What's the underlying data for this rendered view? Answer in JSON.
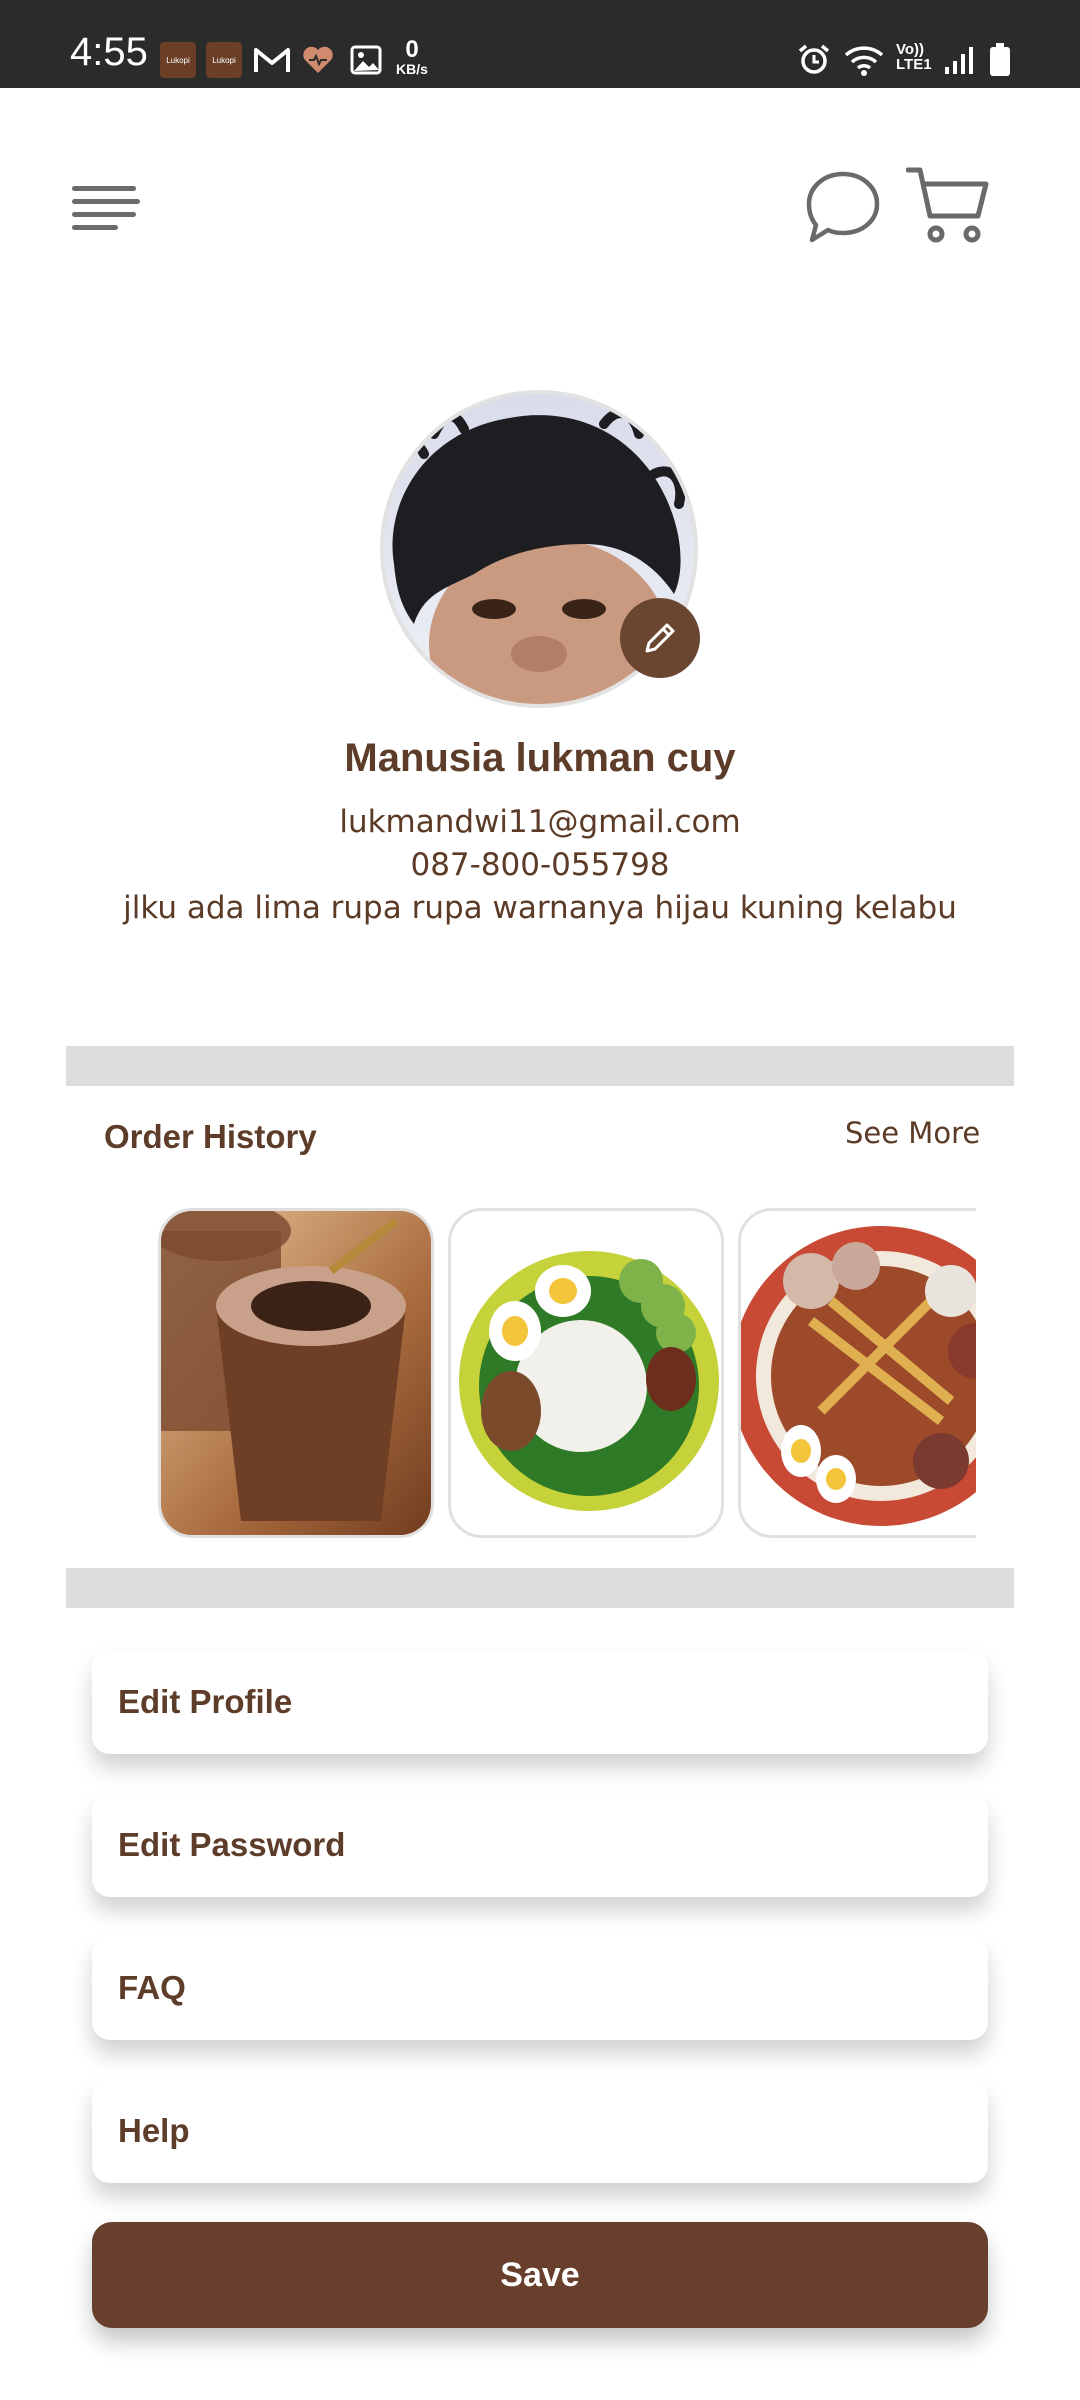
{
  "status_bar": {
    "time": "4:55",
    "app_icon_1": "Lukopi",
    "app_icon_2": "Lukopi",
    "net_speed_value": "0",
    "net_speed_unit": "KB/s",
    "lte_label_1": "Vo))",
    "lte_label_2": "LTE1",
    "icons": [
      "gmail-icon",
      "health-icon",
      "gallery-icon",
      "alarm-icon",
      "wifi-icon",
      "signal-icon",
      "battery-icon"
    ]
  },
  "header": {
    "icons": [
      "menu-icon",
      "chat-icon",
      "cart-icon"
    ]
  },
  "profile": {
    "name": "Manusia lukman cuy",
    "email": "lukmandwi11@gmail.com",
    "phone": "087-800-055798",
    "bio": "jlku ada lima rupa rupa warnanya hijau kuning kelabu"
  },
  "order_history": {
    "title": "Order History",
    "see_more": "See More",
    "items": [
      "chocolate-drink",
      "nasi-lemak",
      "mixed-salad-platter"
    ]
  },
  "menu": {
    "edit_profile": "Edit Profile",
    "edit_password": "Edit Password",
    "faq": "FAQ",
    "help": "Help"
  },
  "save_label": "Save",
  "colors": {
    "primary_brown": "#673f2c",
    "text_brown": "#5d3d29",
    "divider_gray": "#dcdcdc",
    "status_bar": "#2b2b2b"
  }
}
